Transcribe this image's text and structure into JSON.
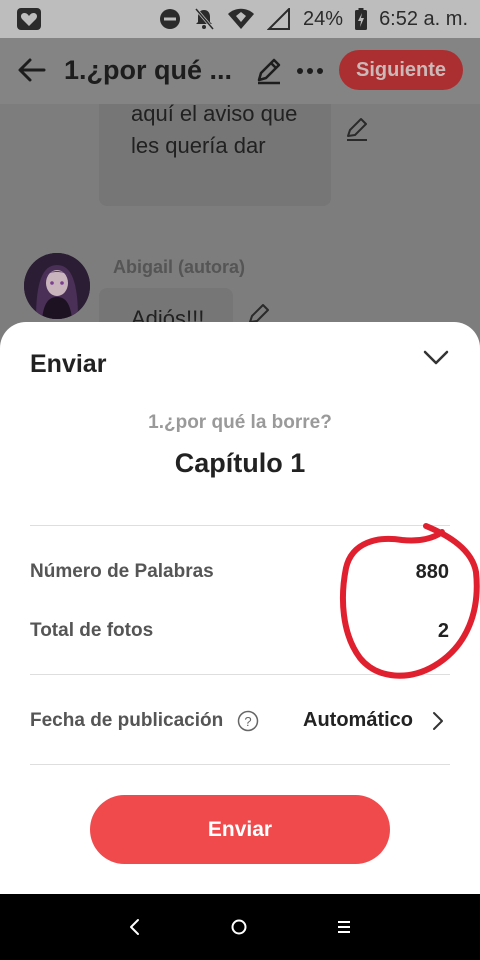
{
  "status_bar": {
    "battery": "24%",
    "time": "6:52 a. m.",
    "icons": [
      "app-notification-icon",
      "do-not-disturb-icon",
      "notifications-muted-icon",
      "wifi-icon",
      "cell-signal-icon",
      "battery-charging-icon"
    ]
  },
  "header": {
    "title": "1.¿por qué ...",
    "next_label": "Siguiente",
    "icons": [
      "back-arrow-icon",
      "pencil-icon",
      "more-dots-icon"
    ]
  },
  "chat": {
    "message1": "aquí el aviso que les quería dar",
    "author": "Abigail (autora)",
    "message2": "Adiós!!!"
  },
  "sheet": {
    "title": "Enviar",
    "story_title": "1.¿por qué la borre?",
    "chapter_title": "Capítulo 1",
    "word_count_label": "Número de Palabras",
    "word_count_value": "880",
    "photos_label": "Total de fotos",
    "photos_value": "2",
    "pub_date_label": "Fecha de publicación",
    "pub_date_value": "Automático",
    "send_button_label": "Enviar",
    "icons": [
      "chevron-down-icon",
      "help-circle-icon",
      "chevron-right-icon"
    ]
  },
  "nav_bar": {
    "icons": [
      "nav-back-icon",
      "nav-home-icon",
      "nav-recents-icon"
    ]
  },
  "colors": {
    "accent": "#f04a4d",
    "annotation": "#e0202e",
    "scrim_header_button": "#ab2f31"
  }
}
